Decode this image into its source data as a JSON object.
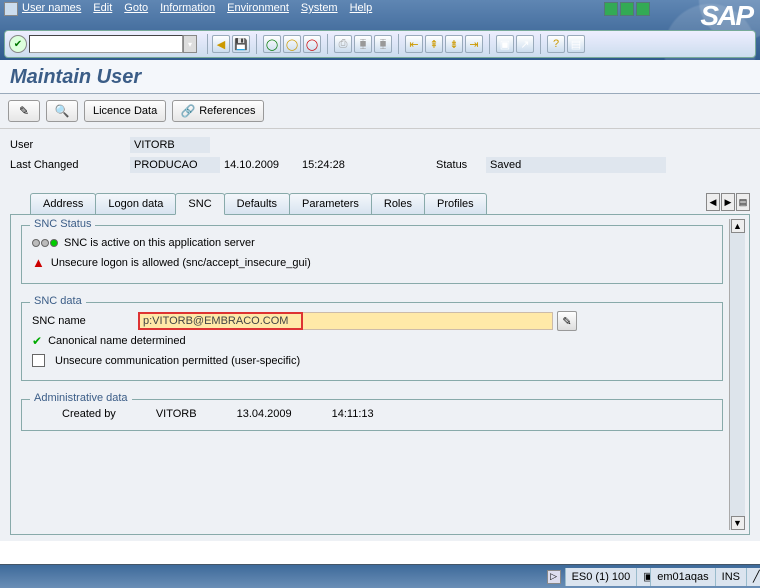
{
  "menu": {
    "items": [
      "User names",
      "Edit",
      "Goto",
      "Information",
      "Environment",
      "System",
      "Help"
    ]
  },
  "brand": "SAP",
  "title": "Maintain User",
  "app_toolbar": {
    "licence": "Licence Data",
    "references": "References"
  },
  "form": {
    "user_label": "User",
    "user_value": "VITORB",
    "last_changed_label": "Last Changed",
    "last_changed_by": "PRODUCAO",
    "last_changed_date": "14.10.2009",
    "last_changed_time": "15:24:28",
    "status_label": "Status",
    "status_value": "Saved"
  },
  "tabs": {
    "items": [
      "Address",
      "Logon data",
      "SNC",
      "Defaults",
      "Parameters",
      "Roles",
      "Profiles"
    ],
    "active_index": 2
  },
  "snc_status": {
    "legend": "SNC Status",
    "line1": "SNC is active on this application server",
    "line2": "Unsecure logon is allowed (snc/accept_insecure_gui)"
  },
  "snc_data": {
    "legend": "SNC data",
    "name_label": "SNC name",
    "name_value": "p:VITORB@EMBRACO.COM",
    "canonical": "Canonical name determined",
    "unsecure_chk": "Unsecure communication permitted (user-specific)"
  },
  "admin": {
    "legend": "Administrative data",
    "created_by_label": "Created by",
    "created_by": "VITORB",
    "created_date": "13.04.2009",
    "created_time": "14:11:13"
  },
  "statusbar": {
    "system": "ES0 (1) 100",
    "server": "em01aqas",
    "mode": "INS"
  }
}
